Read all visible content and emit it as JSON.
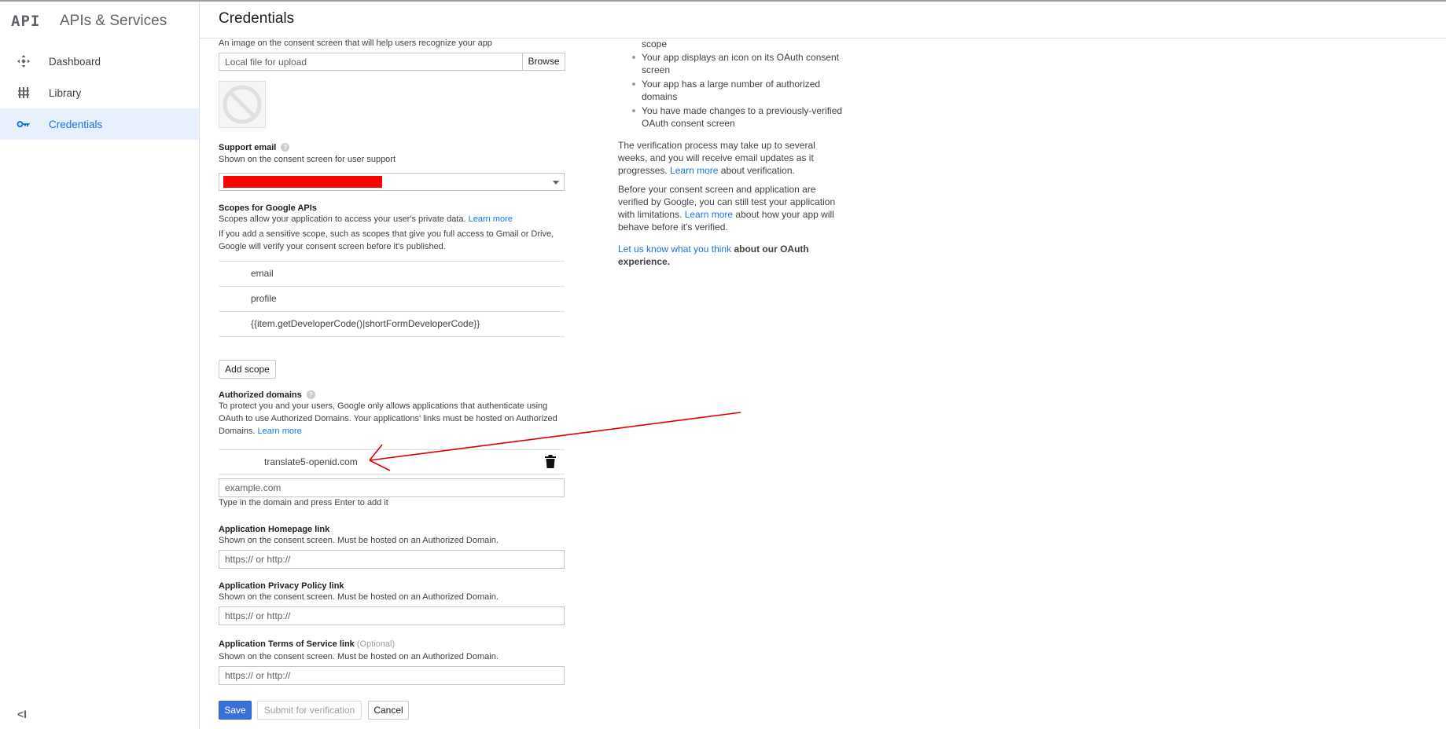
{
  "app": {
    "logo": "API",
    "title": "APIs & Services"
  },
  "sidebar": {
    "items": [
      {
        "label": "Dashboard",
        "icon": "dashboard-icon"
      },
      {
        "label": "Library",
        "icon": "library-icon"
      },
      {
        "label": "Credentials",
        "icon": "key-icon",
        "active": true
      }
    ],
    "collapse": "<I"
  },
  "header": {
    "title": "Credentials"
  },
  "form": {
    "logo_help": "An image on the consent screen that will help users recognize your app",
    "logo_file_placeholder": "Local file for upload",
    "browse_label": "Browse",
    "support_email": {
      "label": "Support email",
      "help": "Shown on the consent screen for user support"
    },
    "scopes": {
      "label": "Scopes for Google APIs",
      "help": "Scopes allow your application to access your user's private data.",
      "learn_more": "Learn more",
      "sensitive_help_1": "If you add a sensitive scope, such as scopes that give you full access to Gmail or Drive,",
      "sensitive_help_2": "Google will verify your consent screen before it's published.",
      "items": [
        "email",
        "profile",
        "{{item.getDeveloperCode()|shortFormDeveloperCode}}"
      ],
      "add_label": "Add scope"
    },
    "domains": {
      "label": "Authorized domains",
      "help_1": "To protect you and your users, Google only allows applications that authenticate using",
      "help_2": "OAuth to use Authorized Domains. Your applications' links must be hosted on Authorized",
      "help_3": "Domains.",
      "learn_more": "Learn more",
      "items": [
        "translate5-openid.com"
      ],
      "input_placeholder": "example.com",
      "input_help": "Type in the domain and press Enter to add it"
    },
    "homepage": {
      "label": "Application Homepage link",
      "help": "Shown on the consent screen. Must be hosted on an Authorized Domain.",
      "placeholder": "https:// or http://"
    },
    "privacy": {
      "label": "Application Privacy Policy link",
      "help": "Shown on the consent screen. Must be hosted on an Authorized Domain.",
      "placeholder": "https:// or http://"
    },
    "terms": {
      "label": "Application Terms of Service link",
      "optional": "(Optional)",
      "help": "Shown on the consent screen. Must be hosted on an Authorized Domain.",
      "placeholder": "https:// or http://"
    },
    "buttons": {
      "save": "Save",
      "submit": "Submit for verification",
      "cancel": "Cancel"
    }
  },
  "info": {
    "bullet_top": "scope",
    "bullets": [
      "Your app displays an icon on its OAuth consent screen",
      "Your app has a large number of authorized domains",
      "You have made changes to a previously-verified OAuth consent screen"
    ],
    "para1_a": "The verification process may take up to several weeks, and you will receive email updates as it progresses.",
    "para1_link": "Learn more",
    "para1_b": "about verification.",
    "para2_a": "Before your consent screen and application are verified by Google, you can still test your application with limitations.",
    "para2_link": "Learn more",
    "para2_b": "about how your app will behave before it's verified.",
    "feedback_link": "Let us know what you think",
    "feedback_b": "about our OAuth experience."
  },
  "colors": {
    "accent": "#1a73e8",
    "annotation": "#e00000",
    "redaction": "#ff0000"
  }
}
